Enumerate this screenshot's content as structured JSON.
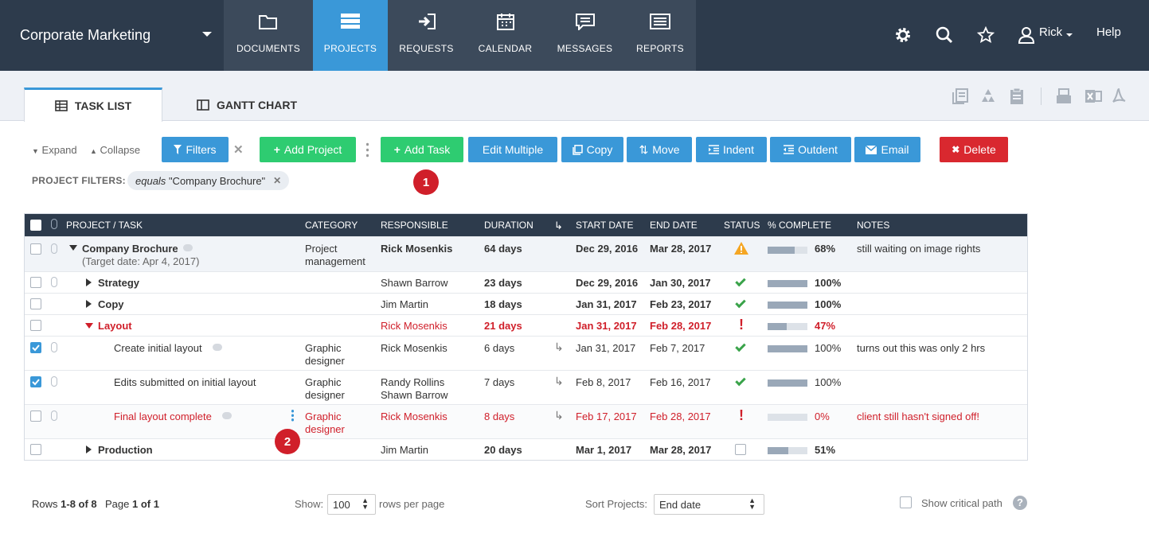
{
  "app": {
    "workspace": "Corporate Marketing"
  },
  "nav": {
    "tabs": [
      {
        "label": "DOCUMENTS",
        "icon": "folder-icon"
      },
      {
        "label": "PROJECTS",
        "icon": "projects-icon",
        "active": true
      },
      {
        "label": "REQUESTS",
        "icon": "login-icon"
      },
      {
        "label": "CALENDAR",
        "icon": "calendar-icon"
      },
      {
        "label": "MESSAGES",
        "icon": "message-icon"
      },
      {
        "label": "REPORTS",
        "icon": "report-icon"
      }
    ],
    "user": "Rick",
    "help": "Help"
  },
  "subtabs": {
    "task_list": "TASK LIST",
    "gantt": "GANTT CHART"
  },
  "toolbar": {
    "expand": "Expand",
    "collapse": "Collapse",
    "filters": "Filters",
    "add_project": "Add Project",
    "add_task": "Add Task",
    "edit_multiple": "Edit Multiple",
    "copy": "Copy",
    "move": "Move",
    "indent": "Indent",
    "outdent": "Outdent",
    "email": "Email",
    "delete": "Delete"
  },
  "filters": {
    "label": "PROJECT FILTERS:",
    "op": "equals",
    "value": "\"Company Brochure\""
  },
  "badges": {
    "one": "1",
    "two": "2"
  },
  "table": {
    "headers": {
      "task": "PROJECT / TASK",
      "category": "CATEGORY",
      "responsible": "RESPONSIBLE",
      "duration": "DURATION",
      "start": "START DATE",
      "end": "END DATE",
      "status": "STATUS",
      "complete": "% COMPLETE",
      "notes": "NOTES"
    },
    "rows": [
      {
        "task": "Company Brochure",
        "sub": "(Target date: Apr 4, 2017)",
        "cat1": "Project",
        "cat2": "management",
        "resp1": "Rick Mosenkis",
        "resp2": "",
        "duration": "64 days",
        "start": "Dec 29, 2016",
        "end": "Mar 28, 2017",
        "pct": "68%",
        "pct_value": 0.68,
        "notes": "still waiting on image rights"
      },
      {
        "task": "Strategy",
        "resp1": "Shawn Barrow",
        "duration": "23 days",
        "start": "Dec 29, 2016",
        "end": "Jan 30, 2017",
        "pct": "100%",
        "pct_value": 1.0
      },
      {
        "task": "Copy",
        "resp1": "Jim Martin",
        "duration": "18 days",
        "start": "Jan 31, 2017",
        "end": "Feb 23, 2017",
        "pct": "100%",
        "pct_value": 1.0
      },
      {
        "task": "Layout",
        "resp1": "Rick Mosenkis",
        "duration": "21 days",
        "start": "Jan 31, 2017",
        "end": "Feb 28, 2017",
        "pct": "47%",
        "pct_value": 0.47,
        "status": "!"
      },
      {
        "task": "Create initial layout",
        "cat1": "Graphic",
        "cat2": "designer",
        "resp1": "Rick Mosenkis",
        "duration": "6 days",
        "start": "Jan 31, 2017",
        "end": "Feb 7, 2017",
        "pct": "100%",
        "pct_value": 1.0,
        "notes": "turns out this was only 2 hrs"
      },
      {
        "task": "Edits submitted on initial layout",
        "cat1": "Graphic",
        "cat2": "designer",
        "resp1": "Randy Rollins",
        "resp2": "Shawn Barrow",
        "duration": "7 days",
        "start": "Feb 8, 2017",
        "end": "Feb 16, 2017",
        "pct": "100%",
        "pct_value": 1.0
      },
      {
        "task": "Final layout complete",
        "cat1": "Graphic",
        "cat2": "designer",
        "resp1": "Rick Mosenkis",
        "duration": "8 days",
        "start": "Feb 17, 2017",
        "end": "Feb 28, 2017",
        "pct": "0%",
        "pct_value": 0.0,
        "notes": "client still hasn't signed off!",
        "status": "!"
      },
      {
        "task": "Production",
        "resp1": "Jim Martin",
        "duration": "20 days",
        "start": "Mar 1, 2017",
        "end": "Mar 28, 2017",
        "pct": "51%",
        "pct_value": 0.51
      }
    ]
  },
  "footer": {
    "rows_label": "Rows",
    "rows_range": "1-8 of 8",
    "page_label": "Page",
    "page_value": "1 of 1",
    "show": "Show:",
    "per_page": "100",
    "rows_per_page": "rows per page",
    "sort_label": "Sort Projects:",
    "sort_value": "End date",
    "critical": "Show critical path",
    "help_q": "?"
  },
  "colors": {
    "accent": "#3a98d8",
    "nav": "#2d3b4c",
    "green": "#2ecc71",
    "red": "#d01f2a"
  }
}
